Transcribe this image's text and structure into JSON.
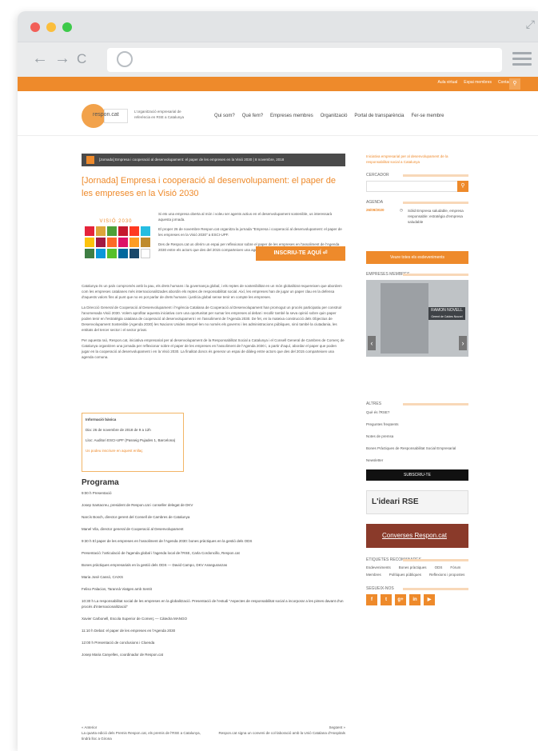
{
  "site": {
    "top_links": [
      "Aula virtual",
      "Espai membres",
      "Contacte"
    ],
    "logo_text": "respon.cat",
    "tagline": "L'organització empresarial de referència en RSE a Catalunya",
    "menu": [
      "Qui som?",
      "Què fem?",
      "Empreses membres",
      "Organització",
      "Portal de transparència",
      "Fer-se membre"
    ]
  },
  "breadcrumb": "[Jornada] Empresa i cooperació al desenvolupament: el paper de les empreses en la Visió 2030 | 8 novembre, 2018",
  "title": "[Jornada] Empresa i cooperació al desenvolupament: el paper de les empreses en la Visió 2030",
  "sdg_label": "VISIÓ 2030",
  "intro": [
    "Si ets una empresa oberta al món i voleu ser agents actius en el desenvolupament sostenible, us interessarà aquesta jornada.",
    "El proper 26 de novembre Respon.cat organitza la jornada \"Empresa i cooperació al desenvolupament: el paper de les empreses en la Visió 2030\" a ESCI-UPF.",
    "Des de Respon.cat us oferim un espai per reflexionar sobre el paper de les empreses en l'assoliment de l'Agenda 2030 entre els actors que des del 2015 comparteixen una agenda comuna."
  ],
  "cta_label": "INSCRIU-TE AQUÍ ⏎",
  "body": [
    "Catalunya és un país compromès amb la pau, els drets humans i la governança global, i els reptes de sostenibilitat en un món globalitzat requereixen que abordem com les empreses catalanes més internacionalitzades abordin els reptes de responsabilitat social. Així, les empreses han de jugar un paper clau en la defensa d'aquests valors fins al punt que no es pot parlar de drets humans i justícia global sense tenir en compte les empreses.",
    "La Direcció General de Cooperació al Desenvolupament i l'Agència Catalana de Cooperació al Desenvolupament han promogut un procés participatiu per construir l'anomenada Visió 2030. Volem aprofitar aquesta iniciativa com una oportunitat per sumar les empreses al debat i recollir també la seva opinió sobre quin paper poden tenir en l'estratègia catalana de cooperació al desenvolupament i en l'assoliment de l'Agenda 2030. De fet, en la mateixa construcció dels Objectius de Desenvolupament Sostenible (Agenda 2030) les Nacions Unides interpel·len no només els governs i les administracions públiques, sinó també la ciutadania, les entitats del tercer sector i el sector privat.",
    "Per aquesta raó, Respon.cat, iniciativa empresarial per al desenvolupament de la Responsabilitat Social a Catalunya i el Consell General de Cambres de Comerç de Catalunya organitzen una jornada per reflexionar sobre el paper de les empreses en l'assoliment de l'Agenda 2030 i, a partir d'aquí, abordar el paper que poden jugar en la cooperació al desenvolupament i en la Visió 2030. La finalitat doncs és generar un espai de diàleg entre actors que des del 2015 comparteixen una agenda comuna."
  ],
  "info": {
    "title": "Informació bàsica",
    "dia": "Dia: 26 de novembre de 2018 de 9 a 12h",
    "lloc": "Lloc: Auditori ESCI-UPF (Passeig Pujades 1, Barcelona)",
    "link_text": "Us podeu inscriure en aquest enllaç"
  },
  "programa": {
    "heading": "Programa",
    "items": [
      "9:00 h Presentació",
      "Josep Santacreu, president de Respon.cat i conseller delegat de DKV",
      "Narcís Bosch, director gerent del Consell de Cambres de Catalunya",
      "Manel Vila, director general de Cooperació al Desenvolupament",
      "9:30 h El paper de les empreses en l'assoliment de l'Agenda 2030: bones pràctiques en la gestió dels ODS",
      "Presentació: l'articulació de l'agenda global i l'agenda local de l'RSE, Carla Cordoncillo, Respon.cat",
      "Bones pràctiques empresarials en la gestió dels ODS — David Campo, DKV Asseguranzas",
      "Maria José Cassó, CAIXS",
      "Feliso Palacios, Tarannà Viatges amb Sentit",
      "10:30 h La responsabilitat social de les empreses en la globalització. Presentació de l'estudi \"Aspectes de responsabilitat social a incorporar a les pimes davant d'un procés d'internacionalització\"",
      "Xavier Carbonell, Escola Superior de Comerç — Càtedra MANGO",
      "11:10 h Debat: el paper de les empreses en l'Agenda 2030",
      "12:00 h Presentació de conclusions i Cloenda",
      "Josep Maria Canyelles, coordinador de Respon.cat"
    ]
  },
  "prev": {
    "label": "« Anterior",
    "text": "La quarta edició dels Premis Respon.cat, els premis de l'RSE a Catalunya, tindrà lloc a Girona"
  },
  "next": {
    "label": "Següent »",
    "text": "Respon.cat signa un conveni de col·laboració amb la Unió Catalana d'Hospitals"
  },
  "sidebar": {
    "intro": "Iniciativa empresarial per al desenvolupament de la responsabilitat social a Catalunya",
    "cercador": "CERCADOR",
    "agenda": "AGENDA",
    "agenda_date": "26/09/2020",
    "agenda_text": "Sòlid Empresa saludable, empresa responsable: estratègia d'empresa saludable",
    "agenda_btn": "Veure totes els esdeveniments",
    "members": "EMPRESES MEMBRES",
    "member_name": "RAMON NOVELL",
    "member_role": "Gerent de Caldes Nouvel",
    "altres": "ALTRES",
    "altres_items": [
      "Què és l'RSE?",
      "Preguntes freqüents",
      "Notes de premsa",
      "Bones Pràctiques de Responsabilitat Social Empresarial",
      "Newsletter"
    ],
    "subscribe": "SUBSCRIU-TE",
    "ideari": "L'ideari RSE",
    "converses": "Converses Respon.cat",
    "tags_title": "ETIQUETES RECOMANADES",
    "tags": [
      "Esdeveniments",
      "Bones pràctiques",
      "ODS",
      "Fòrum",
      "Membres",
      "Polítiques públiques",
      "Reflexions i propostes"
    ],
    "social_title": "SEGUEIX-NOS",
    "social": [
      "f",
      "t",
      "g+",
      "in",
      "▶"
    ]
  }
}
